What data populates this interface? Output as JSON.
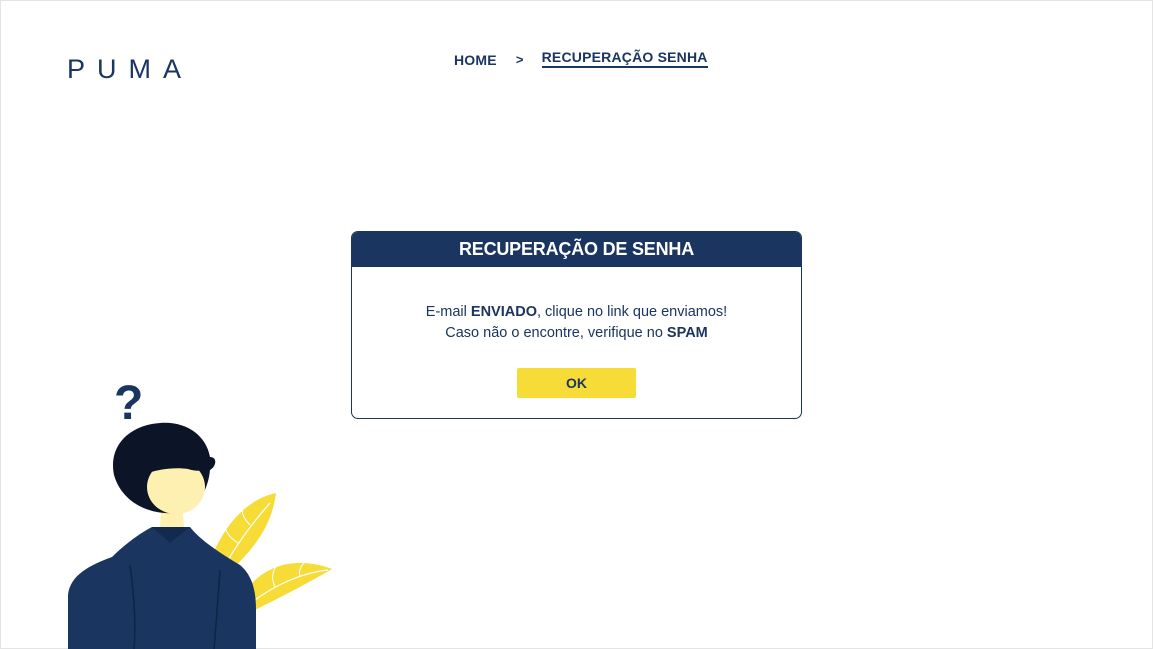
{
  "brand": {
    "logo_text": "PUMA"
  },
  "breadcrumb": {
    "home_label": "HOME",
    "separator": ">",
    "current_label": "RECUPERAÇÃO SENHA"
  },
  "modal": {
    "title": "RECUPERAÇÃO DE SENHA",
    "line1_prefix": "E-mail ",
    "line1_bold": "ENVIADO",
    "line1_suffix": ", clique no link que enviamos!",
    "line2_prefix": "Caso não o encontre, verifique no ",
    "line2_bold": "SPAM",
    "ok_label": "OK"
  },
  "illustration": {
    "question_mark": "?"
  },
  "colors": {
    "primary": "#1a3560",
    "accent": "#f7dc37",
    "skin": "#fdf0b0",
    "hair": "#0b1527"
  }
}
